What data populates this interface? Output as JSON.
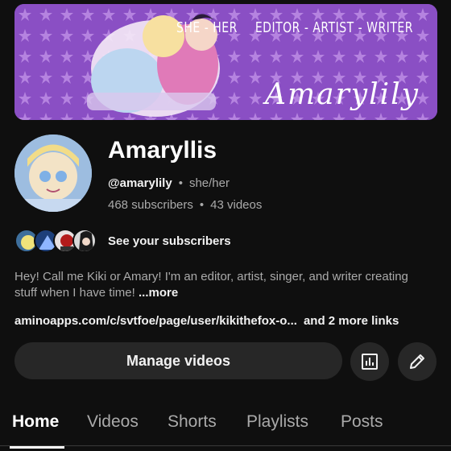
{
  "banner": {
    "tags": [
      "SHE - HER",
      "EDITOR - ARTIST - WRITER"
    ],
    "script_text": "Amarylily"
  },
  "channel": {
    "name": "Amaryllis",
    "handle": "@amarylily",
    "pronouns": "she/her",
    "subscribers": "468 subscribers",
    "videos": "43 videos",
    "see_subscribers": "See your subscribers",
    "description": "Hey! Call me Kiki or Amary! I'm an editor, artist, singer, and writer creating stuff when I have time!",
    "more_label": "...more",
    "link": "aminoapps.com/c/svtfoe/page/user/kikithefox-o...",
    "more_links": "and 2 more links"
  },
  "actions": {
    "manage_videos": "Manage videos",
    "analytics_icon": "analytics-icon",
    "edit_icon": "pencil-icon"
  },
  "tabs": [
    "Home",
    "Videos",
    "Shorts",
    "Playlists",
    "Posts"
  ],
  "colors": {
    "background": "#0f0f0f",
    "banner_purple": "#8a4fc4",
    "button_bg": "#272727",
    "secondary_text": "#aaaaaa"
  }
}
